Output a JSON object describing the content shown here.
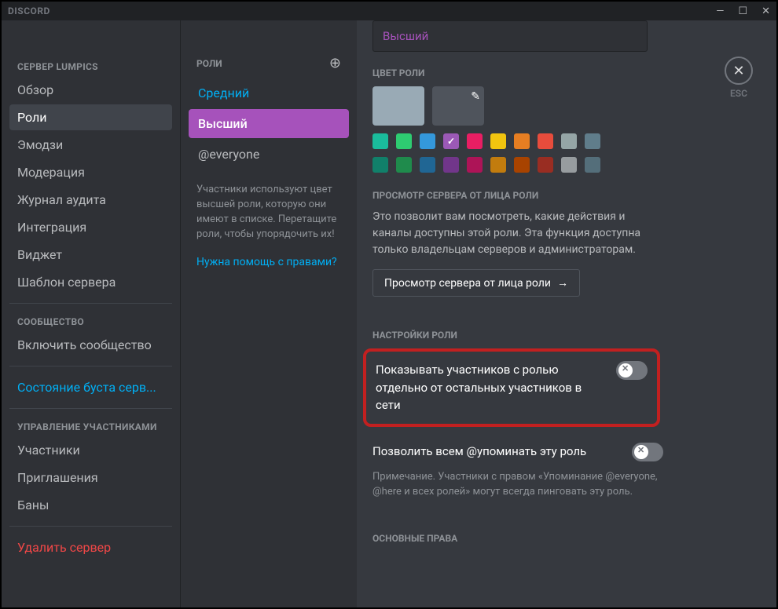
{
  "titlebar": {
    "brand": "DISCORD"
  },
  "close_label": "ESC",
  "left": {
    "server_header": "СЕРВЕР LUMPICS",
    "items1": [
      "Обзор",
      "Роли",
      "Эмодзи",
      "Модерация",
      "Журнал аудита",
      "Интеграция",
      "Виджет",
      "Шаблон сервера"
    ],
    "community_header": "СООБЩЕСТВО",
    "items2": [
      "Включить сообщество"
    ],
    "boost": "Состояние буста серв...",
    "members_header": "УПРАВЛЕНИЕ УЧАСТНИКАМИ",
    "items3": [
      "Участники",
      "Приглашения",
      "Баны"
    ],
    "delete": "Удалить сервер"
  },
  "roles_col": {
    "header": "РОЛИ",
    "roles": [
      "Средний",
      "Высший",
      "@everyone"
    ],
    "note": "Участники используют цвет высшей роли, которую они имеют в списке. Перетащите роли, чтобы упорядочить их!",
    "help": "Нужна помощь с правами?"
  },
  "main": {
    "role_name_value": "Высший",
    "color_label": "ЦВЕТ РОЛИ",
    "view_as_label": "ПРОСМОТР СЕРВЕРА ОТ ЛИЦА РОЛИ",
    "view_as_help": "Это позволит вам посмотреть, какие действия и каналы доступны этой роли. Эта функция доступна только владельцам серверов и администраторам.",
    "view_as_btn": "Просмотр сервера от лица роли",
    "role_settings_label": "НАСТРОЙКИ РОЛИ",
    "display_separate": "Показывать участников с ролью отдельно от остальных участников в сети",
    "allow_mention": "Позволить всем @упоминать эту роль",
    "mention_note": "Примечание. Участники с правом «Упоминание @everyone, @here и всех ролей» могут всегда пинговать эту роль.",
    "core_rights_label": "ОСНОВНЫЕ ПРАВА",
    "colors_row1": [
      "#1abc9c",
      "#2ecc71",
      "#3498db",
      "#9b59b6",
      "#e91e63",
      "#f1c40f",
      "#e67e22",
      "#e74c3c",
      "#95a5a6",
      "#607d8b"
    ],
    "colors_row2": [
      "#11806a",
      "#1f8b4c",
      "#206694",
      "#71368a",
      "#ad1457",
      "#c27c0e",
      "#a84300",
      "#992d22",
      "#979c9f",
      "#546e7a"
    ]
  }
}
